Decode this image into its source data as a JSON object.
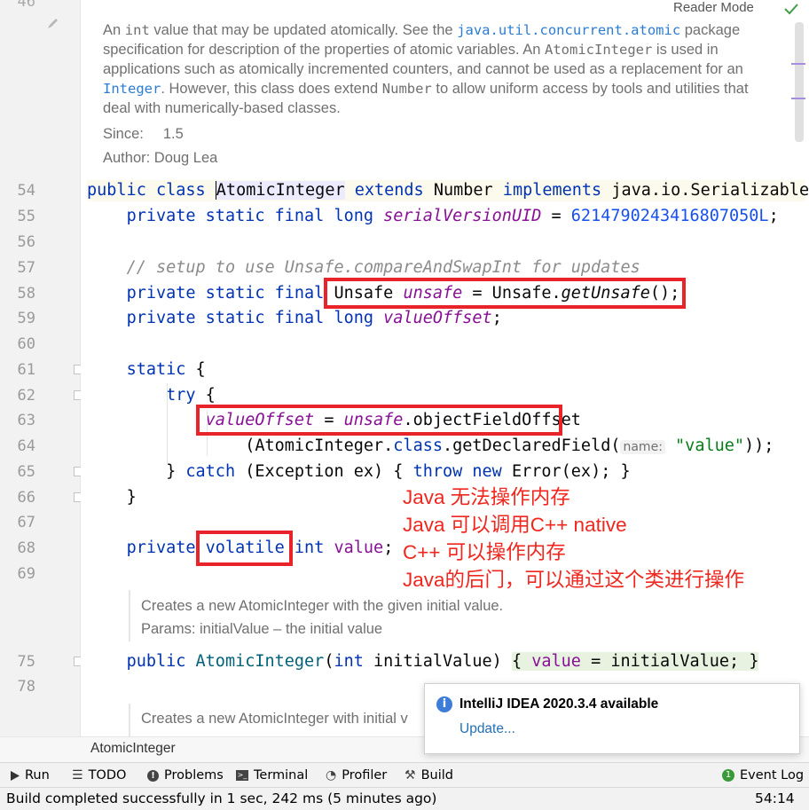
{
  "reader_mode": "Reader Mode",
  "doc_top": {
    "p1": "An ",
    "p1_code": "int",
    "p2": " value that may be updated atomically. See the ",
    "p2_link": "java.util.concurrent.atomic",
    "p3": " package",
    "line2a": "specification for description of the properties of atomic variables. An ",
    "line2_code": "AtomicInteger",
    "line2b": " is used in",
    "line3": "applications such as atomically incremented counters, and cannot be used as a replacement for an",
    "line4_link": "Integer",
    "line4a": ". However, this class does extend ",
    "line4_code": "Number",
    "line4b": " to allow uniform access by tools and utilities that",
    "line5": "deal with numerically-based classes.",
    "since_label": "Since:",
    "since_value": "1.5",
    "author": "Author: Doug Lea"
  },
  "line_numbers": [
    "54",
    "55",
    "56",
    "57",
    "58",
    "59",
    "60",
    "61",
    "62",
    "63",
    "64",
    "65",
    "66",
    "67",
    "68",
    "69",
    "75",
    "78"
  ],
  "code": {
    "l54": {
      "kw1": "public class ",
      "cls": "AtomicInteger",
      "kw2": " extends ",
      "sup": "Number",
      "kw3": " implements ",
      "iface": "java.io.Serializable"
    },
    "l55": {
      "kw": "private static final long ",
      "fld": "serialVersionUID",
      "eq": " = ",
      "num": "6214790243416807050L",
      "end": ";"
    },
    "l57": {
      "cmt": "// setup to use Unsafe.compareAndSwapInt for updates"
    },
    "l58": {
      "kw": "private static final ",
      "type": "Unsafe ",
      "fld": "unsafe",
      "eq": " = Unsafe.",
      "mcall": "getUnsafe",
      "end": "();"
    },
    "l59": {
      "kw": "private static final long ",
      "fld": "valueOffset",
      "end": ";"
    },
    "l61": {
      "kw": "static",
      "end": " {"
    },
    "l62": {
      "kw": "try",
      "end": " {"
    },
    "l63": {
      "fld1": "valueOffset",
      "eq": " = ",
      "fld2": "unsafe",
      "rest": ".objectFieldOffset"
    },
    "l64": {
      "a": "(AtomicInteger.",
      "kw": "class",
      "b": ".getDeclaredField(",
      "hint": "name:",
      "str": "\"value\"",
      "c": "));"
    },
    "l65": {
      "a": "} ",
      "kw1": "catch",
      "b": " (Exception ex) { ",
      "kw2": "throw new",
      "c": " Error(ex); }"
    },
    "l66": {
      "a": "}"
    },
    "l68": {
      "kw1": "private ",
      "kw2": "volatile",
      "kw3": " int ",
      "fld": "value",
      "end": ";"
    },
    "l75": {
      "kw1": "public ",
      "ctor": "AtomicInteger",
      "a": "(",
      "kw2": "int",
      "b": " initialValue) ",
      "c": "{ ",
      "fld": "value",
      "d": " = initialValue; ",
      "e": "}"
    }
  },
  "doc_ctor1": {
    "line1": "Creates a new AtomicInteger with the given initial value.",
    "line2": "Params: initialValue – the initial value"
  },
  "doc_ctor2": {
    "line1": "Creates a new AtomicInteger with initial v"
  },
  "annotations": [
    "Java 无法操作内存",
    "Java 可以调用C++ native",
    "C++ 可以操作内存",
    "Java的后门，可以通过这个类进行操作"
  ],
  "breadcrumb": "AtomicInteger",
  "notification": {
    "title": "IntelliJ IDEA 2020.3.4 available",
    "link": "Update..."
  },
  "toolbar": {
    "run": "Run",
    "todo": "TODO",
    "problems": "Problems",
    "terminal": "Terminal",
    "profiler": "Profiler",
    "build": "Build",
    "event_log": "Event Log"
  },
  "status": {
    "message": "Build completed successfully in 1 sec, 242 ms (5 minutes ago)",
    "position": "54:14"
  },
  "colors": {
    "keyword": "#0033b3",
    "field": "#871094",
    "number": "#1750eb",
    "string": "#067d17",
    "annotation_red": "#e8232a",
    "notif_info": "#3d7dd8",
    "event_log_badge": "#3a9a3a"
  }
}
